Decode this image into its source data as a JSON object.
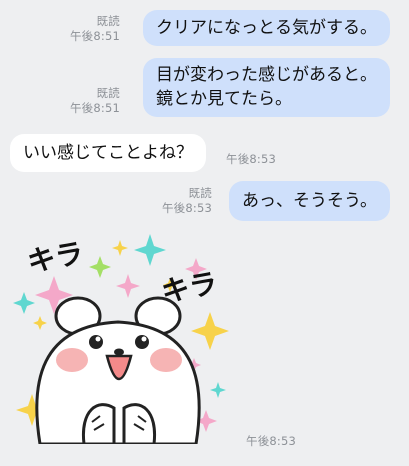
{
  "messages": [
    {
      "direction": "out",
      "read": "既読",
      "time": "午後8:51",
      "lines": [
        "クリアになっとる気がする。"
      ]
    },
    {
      "direction": "out",
      "read": "既読",
      "time": "午後8:51",
      "lines": [
        "目が変わった感じがあると。",
        "鏡とか見てたら。"
      ]
    },
    {
      "direction": "in",
      "time": "午後8:53",
      "lines": [
        "いい感じてことよね？"
      ]
    },
    {
      "direction": "out",
      "read": "既読",
      "time": "午後8:53",
      "lines": [
        "あっ、そうそう。"
      ]
    },
    {
      "direction": "in",
      "time": "午後8:53",
      "sticker": {
        "text_top": "キラ",
        "text_right": "キラ",
        "icon": "white-bear-sparkle-sticker"
      }
    }
  ],
  "colors": {
    "background": "#eeeff1",
    "outgoing_bubble": "#cfe0fb",
    "incoming_bubble": "#ffffff",
    "meta_text": "#8d9197"
  }
}
